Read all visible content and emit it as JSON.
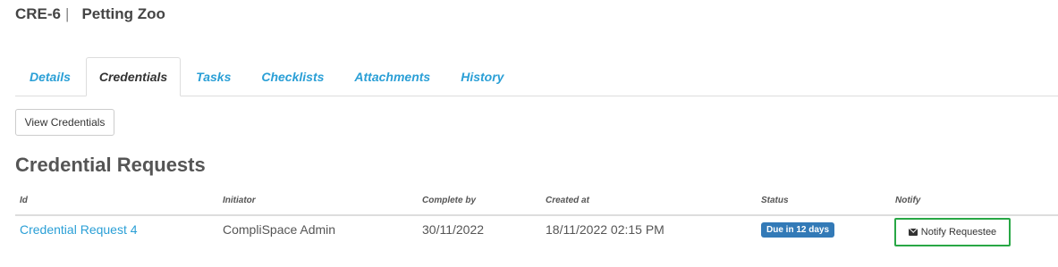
{
  "header": {
    "code": "CRE-6",
    "separator": "|",
    "title": "Petting Zoo"
  },
  "tabs": [
    {
      "label": "Details"
    },
    {
      "label": "Credentials",
      "active": true
    },
    {
      "label": "Tasks"
    },
    {
      "label": "Checklists"
    },
    {
      "label": "Attachments"
    },
    {
      "label": "History"
    }
  ],
  "view_credentials_label": "View Credentials",
  "section_title": "Credential Requests",
  "table": {
    "columns": [
      "Id",
      "Initiator",
      "Complete by",
      "Created at",
      "Status",
      "Notify"
    ],
    "rows": [
      {
        "id": "Credential Request 4",
        "initiator": "CompliSpace Admin",
        "complete_by": "30/11/2022",
        "created_at": "18/11/2022 02:15 PM",
        "status": "Due in 12 days",
        "notify_label": "Notify Requestee"
      }
    ]
  },
  "colors": {
    "link": "#2a9fd6",
    "status_badge": "#337ab7",
    "highlight_border": "#28a745"
  },
  "icons": {
    "notify": "envelope-icon"
  }
}
